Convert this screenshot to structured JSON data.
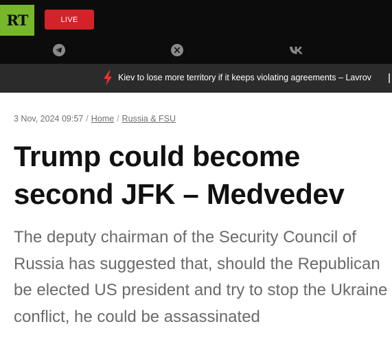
{
  "header": {
    "logo_text": "RT",
    "live_label": "LIVE",
    "logo_color": "#77b72a",
    "live_color": "#d32328",
    "social": [
      "telegram-icon",
      "x-icon",
      "vk-icon"
    ]
  },
  "ticker": {
    "text": "Kiev to lose more territory if it keeps violating agreements – Lavrov",
    "icon": "lightning-icon"
  },
  "breadcrumb": {
    "date": "3 Nov, 2024 09:57",
    "home": "Home",
    "section": "Russia & FSU"
  },
  "article": {
    "title": "Trump could become second JFK – Medvedev",
    "lead": "The deputy chairman of the Security Council of Russia has suggested that, should the Republican be elected US president and try to stop the Ukraine conflict, he could be assassinated"
  }
}
